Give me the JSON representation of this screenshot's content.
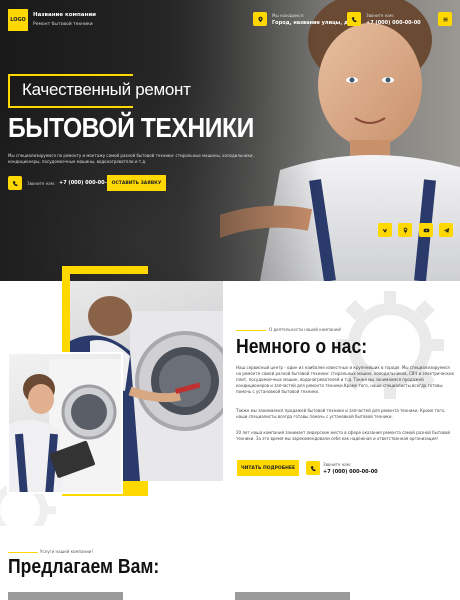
{
  "header": {
    "logo_text": "LOGO",
    "company_name": "Название компании",
    "company_sub": "Ремонт бытовой техники",
    "address_label": "Мы находимся:",
    "address_value": "Город, название улицы, дом",
    "phone_label": "Звоните нам:",
    "phone_value": "+7 (000) 000-00-00"
  },
  "hero": {
    "title_line1": "Качественный ремонт",
    "title_line2": "БЫТОВОЙ ТЕХНИКИ",
    "description": "Мы специализируемся по ремонту и монтажу самой разной бытовой техники: стиральные машины, холодильники, кондиционеры, посудомоечные машины, водонагреватели и т.д.",
    "call_label": "Звоните нам:",
    "call_value": "+7 (000) 000-00-00",
    "order_button": "ОСТАВИТЬ ЗАЯВКУ",
    "social": [
      "vk",
      "ok",
      "yt",
      "tg"
    ]
  },
  "about": {
    "kicker": "О деятельности нашей компании!",
    "title": "Немного о нас:",
    "p1": "Наш сервисный центр - один из наиболее известных и крупнейших в городе. Мы специализируемся на ремонте самой разной бытовой техники: стиральных машин, холодильников, СВЧ и электрических плит, посудомоечных машин, водонагревателей и т.д. Также мы занимаемся продажей кондиционеров и запчастей для ремонта техники.Кроме того, наши специалисты всегда готовы помочь с установкой бытовой техники.",
    "p2": "Также мы занимаемся продажей бытовой техники и запчастей для ремонта техники. Кроме того, наши специалисты всегда готовы помочь с установкой бытовой техники.",
    "p3": "20 лет наша компания занимает лидерские места в сфере оказания ремонта самой разной бытовой техники. За это время мы зарекомендовали себя как надежная и ответственная организация!",
    "button": "ЧИТАТЬ ПОДРОБНЕЕ",
    "phone_label": "Звоните нам:",
    "phone_value": "+7 (000) 000-00-00"
  },
  "services": {
    "kicker": "Услуги нашей компании!",
    "title": "Предлагаем Вам:"
  },
  "colors": {
    "accent": "#ffd800",
    "dark": "#222222"
  }
}
